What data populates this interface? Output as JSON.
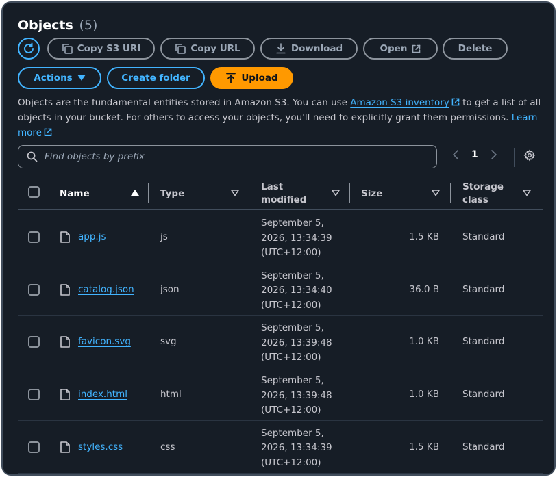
{
  "header": {
    "title": "Objects",
    "count": "(5)"
  },
  "toolbar": {
    "refresh_icon": "refresh-icon",
    "copy_s3_uri": "Copy S3 URI",
    "copy_url": "Copy URL",
    "download": "Download",
    "open": "Open",
    "delete": "Delete",
    "actions": "Actions",
    "create_folder": "Create folder",
    "upload": "Upload"
  },
  "description": {
    "part1": "Objects are the fundamental entities stored in Amazon S3. You can use ",
    "inventory_link": "Amazon S3 inventory",
    "part2": " to get a list of all objects in your bucket. For others to access your objects, you'll need to explicitly grant them permissions. ",
    "learn_more": "Learn more"
  },
  "search": {
    "placeholder": "Find objects by prefix"
  },
  "pagination": {
    "current_page": "1"
  },
  "table": {
    "columns": {
      "name": "Name",
      "type": "Type",
      "last_modified": "Last modified",
      "size": "Size",
      "storage_class": "Storage class"
    },
    "rows": [
      {
        "name": "app.js",
        "type": "js",
        "date": "September 5,",
        "time": "2026, 13:34:39",
        "tz": "(UTC+12:00)",
        "size": "1.5 KB",
        "storage": "Standard"
      },
      {
        "name": "catalog.json",
        "type": "json",
        "date": "September 5,",
        "time": "2026, 13:34:40",
        "tz": "(UTC+12:00)",
        "size": "36.0 B",
        "storage": "Standard"
      },
      {
        "name": "favicon.svg",
        "type": "svg",
        "date": "September 5,",
        "time": "2026, 13:39:48",
        "tz": "(UTC+12:00)",
        "size": "1.0 KB",
        "storage": "Standard"
      },
      {
        "name": "index.html",
        "type": "html",
        "date": "September 5,",
        "time": "2026, 13:39:48",
        "tz": "(UTC+12:00)",
        "size": "1.0 KB",
        "storage": "Standard"
      },
      {
        "name": "styles.css",
        "type": "css",
        "date": "September 5,",
        "time": "2026, 13:34:39",
        "tz": "(UTC+12:00)",
        "size": "1.5 KB",
        "storage": "Standard"
      }
    ]
  },
  "colors": {
    "background": "#161d26",
    "accent": "#42b4ff",
    "primary_button": "#ff9900",
    "border": "#8c939c"
  }
}
